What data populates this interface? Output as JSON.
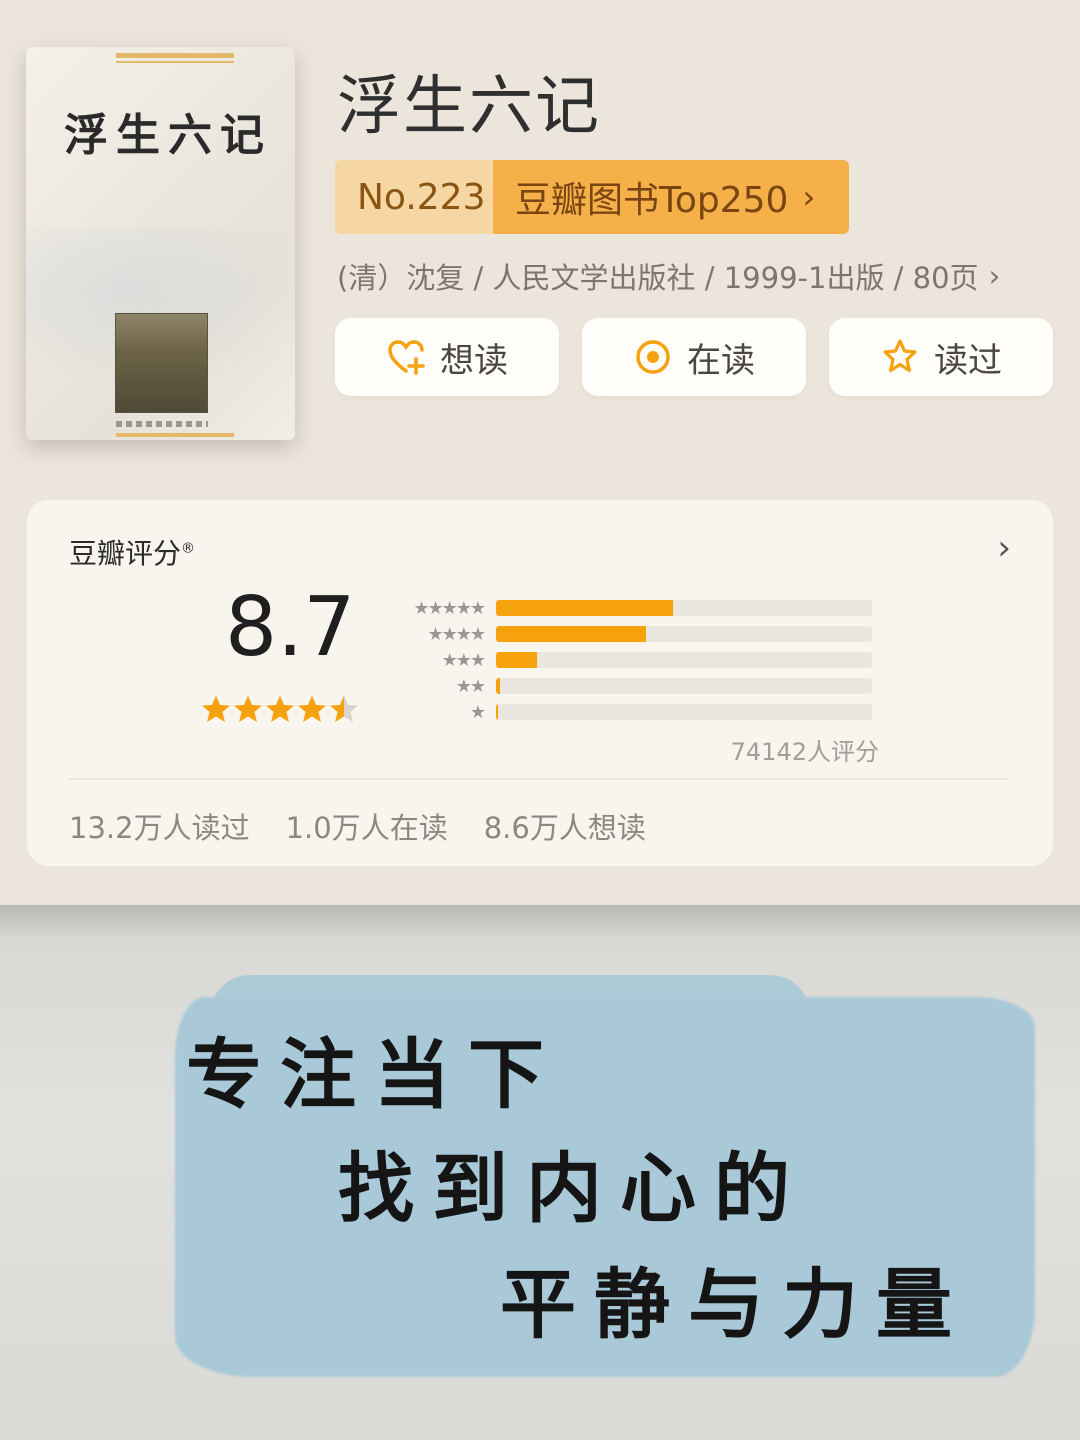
{
  "book": {
    "cover_title": "浮生六记",
    "title": "浮生六记",
    "rank_no": "No.223",
    "rank_list": "豆瓣图书Top250",
    "meta": "(清）沈复 / 人民文学出版社 / 1999-1出版 / 80页"
  },
  "actions": [
    {
      "label": "想读",
      "icon": "heart-plus-icon"
    },
    {
      "label": "在读",
      "icon": "target-icon"
    },
    {
      "label": "读过",
      "icon": "star-outline-icon"
    }
  ],
  "rating": {
    "title": "豆瓣评分",
    "reg": "®",
    "score": "8.7",
    "score_value": 8.7,
    "star_level": 4.5,
    "count": "74142人评分",
    "distribution": [
      {
        "stars": "★★★★★",
        "fraction": 0.47
      },
      {
        "stars": "★★★★",
        "fraction": 0.4
      },
      {
        "stars": "★★★",
        "fraction": 0.11
      },
      {
        "stars": "★★",
        "fraction": 0.01
      },
      {
        "stars": "★",
        "fraction": 0.005
      }
    ],
    "stats": [
      "13.2万人读过",
      "1.0万人在读",
      "8.6万人想读"
    ]
  },
  "banner": {
    "line1": "专注当下",
    "line2": "找到内心的",
    "line3": "平静与力量"
  },
  "colors": {
    "accent": "#f6a20e",
    "rank_bg": "#f5b04a",
    "rank_no_bg": "#f6d7a4",
    "wash": "#a9c9d8"
  }
}
